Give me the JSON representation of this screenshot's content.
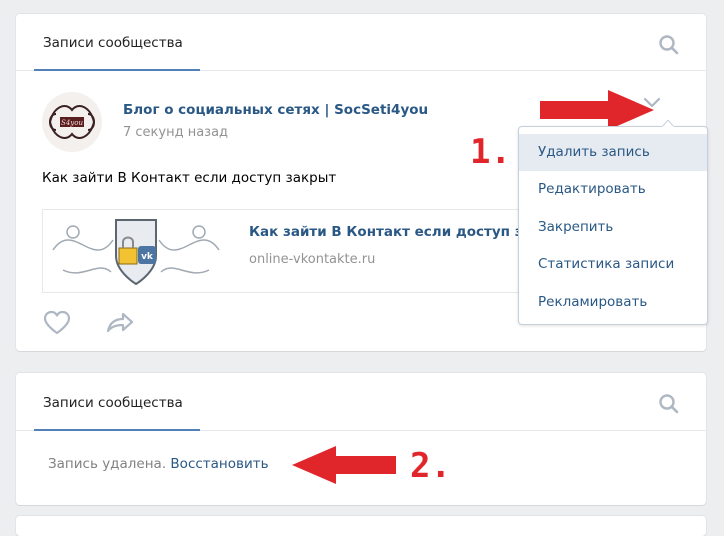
{
  "posts_card": {
    "tab_label": "Записи сообщества",
    "post": {
      "author": "Блог о социальных сетях | SocSeti4you",
      "time": "7 секунд назад",
      "text": "Как зайти В Контакт если доступ закрыт",
      "attachment": {
        "title": "Как зайти В Контакт если доступ закрыт",
        "domain": "online-vkontakte.ru"
      }
    },
    "menu": {
      "items": [
        "Удалить запись",
        "Редактировать",
        "Закрепить",
        "Статистика записи",
        "Рекламировать"
      ],
      "hovered_index": 0
    }
  },
  "deleted_card": {
    "tab_label": "Записи сообщества",
    "deleted_text": "Запись удалена.",
    "restore_link": "Восстановить"
  },
  "annotations": {
    "step1": "1.",
    "step2": "2."
  },
  "colors": {
    "link_blue": "#2a5885",
    "accent_blue": "#5181b8",
    "annotation_red": "#e0262b",
    "page_bg": "#edeef0"
  }
}
